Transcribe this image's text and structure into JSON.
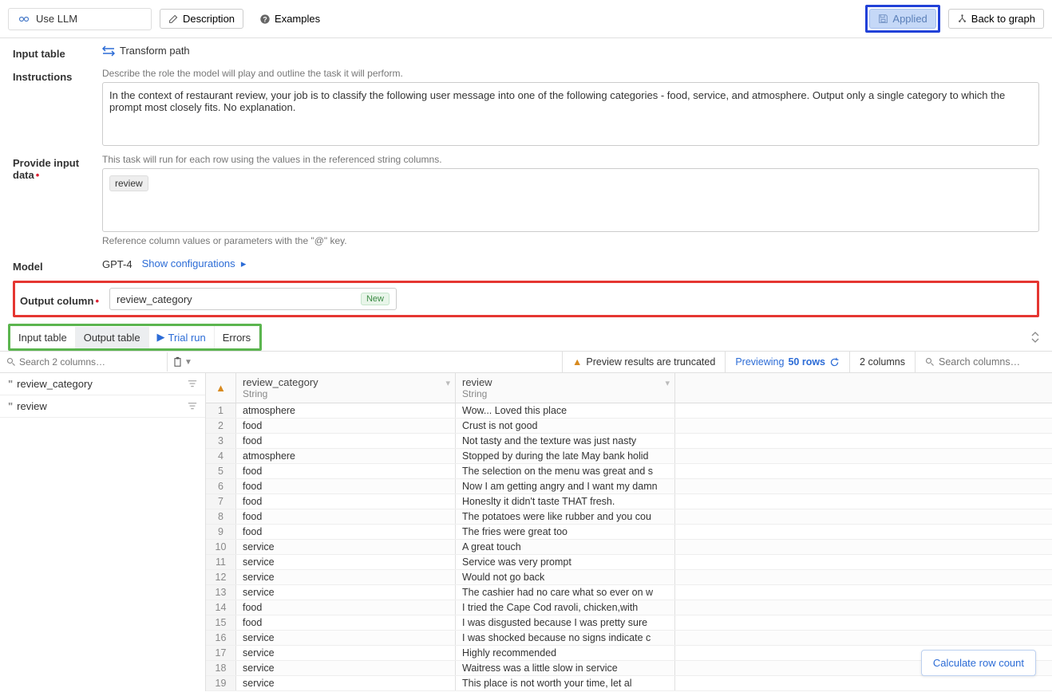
{
  "toolbar": {
    "use_llm": "Use LLM",
    "description": "Description",
    "examples": "Examples",
    "applied": "Applied",
    "back_to_graph": "Back to graph"
  },
  "form": {
    "input_table_label": "Input table",
    "transform_path": "Transform path",
    "instructions_label": "Instructions",
    "instructions_hint": "Describe the role the model will play and outline the task it will perform.",
    "instructions_value": "In the context of restaurant review, your job is to classify the following user message into one of the following categories - food, service, and atmosphere. Output only a single category to which the prompt most closely fits. No explanation.",
    "provide_input_label": "Provide input data",
    "provide_input_hint": "This task will run for each row using the values in the referenced string columns.",
    "provide_input_chip": "review",
    "provide_input_ref_hint": "Reference column values or parameters with the \"@\" key.",
    "model_label": "Model",
    "model_value": "GPT-4",
    "show_config": "Show configurations",
    "output_col_label": "Output column",
    "output_col_value": "review_category",
    "new_badge": "New"
  },
  "tabs": {
    "input_table": "Input table",
    "output_table": "Output table",
    "trial_run": "Trial run",
    "errors": "Errors"
  },
  "midbar": {
    "search_placeholder": "Search 2 columns…",
    "truncated_warning": "Preview results are truncated",
    "previewing_label": "Previewing",
    "previewing_count": "50 rows",
    "col_count": "2 columns",
    "search_cols_placeholder": "Search columns…"
  },
  "sidebar": {
    "items": [
      "review_category",
      "review"
    ]
  },
  "table": {
    "columns": [
      {
        "name": "review_category",
        "type": "String"
      },
      {
        "name": "review",
        "type": "String"
      }
    ],
    "rows": [
      {
        "n": 1,
        "cat": "atmosphere",
        "rev": "Wow... Loved this place"
      },
      {
        "n": 2,
        "cat": "food",
        "rev": "Crust is not good"
      },
      {
        "n": 3,
        "cat": "food",
        "rev": "Not tasty and the texture was just nasty"
      },
      {
        "n": 4,
        "cat": "atmosphere",
        "rev": "Stopped by during the late May bank holid"
      },
      {
        "n": 5,
        "cat": "food",
        "rev": "The selection on the menu was great and s"
      },
      {
        "n": 6,
        "cat": "food",
        "rev": "Now I am getting angry and I want my damn"
      },
      {
        "n": 7,
        "cat": "food",
        "rev": "Honeslty it didn't taste THAT fresh."
      },
      {
        "n": 8,
        "cat": "food",
        "rev": "The potatoes were like rubber and you cou"
      },
      {
        "n": 9,
        "cat": "food",
        "rev": "The fries were great too"
      },
      {
        "n": 10,
        "cat": "service",
        "rev": "A great touch"
      },
      {
        "n": 11,
        "cat": "service",
        "rev": "Service was very prompt"
      },
      {
        "n": 12,
        "cat": "service",
        "rev": "Would not go back"
      },
      {
        "n": 13,
        "cat": "service",
        "rev": "The cashier had no care what so ever on w"
      },
      {
        "n": 14,
        "cat": "food",
        "rev": "I tried the Cape Cod ravoli, chicken,with"
      },
      {
        "n": 15,
        "cat": "food",
        "rev": "I was disgusted because I was pretty sure"
      },
      {
        "n": 16,
        "cat": "service",
        "rev": "I was shocked because no signs indicate c"
      },
      {
        "n": 17,
        "cat": "service",
        "rev": "Highly recommended"
      },
      {
        "n": 18,
        "cat": "service",
        "rev": "Waitress was a little slow in service"
      },
      {
        "n": 19,
        "cat": "service",
        "rev": "This place is not worth your time, let al"
      }
    ]
  },
  "footer": {
    "calculate": "Calculate row count"
  }
}
